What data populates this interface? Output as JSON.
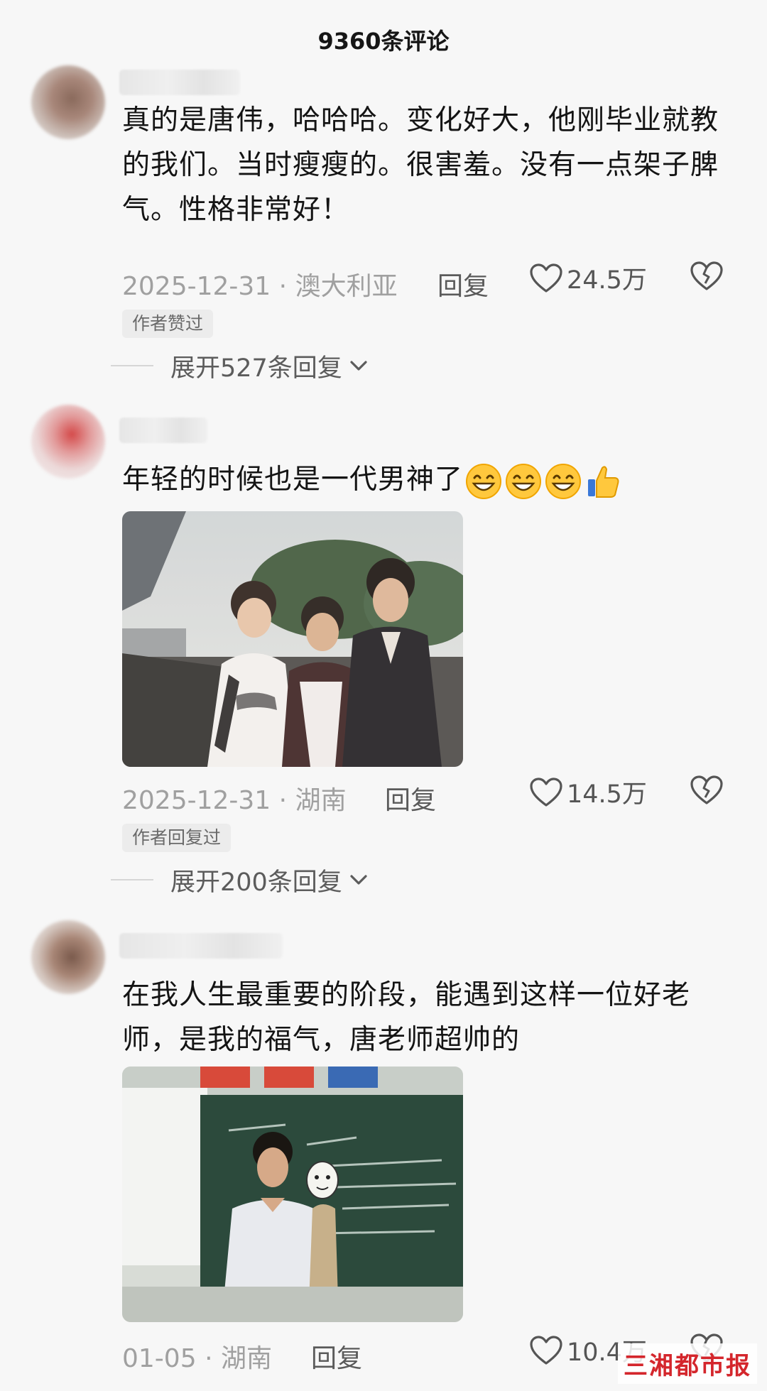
{
  "header": {
    "title": "9360条评论"
  },
  "comments": [
    {
      "text": "真的是唐伟，哈哈哈。变化好大，他刚毕业就教的我们。当时瘦瘦的。很害羞。没有一点架子脾气。性格非常好！",
      "date": "2025-12-31",
      "location": "澳大利亚",
      "reply_label": "回复",
      "likes": "24.5万",
      "tag": "作者赞过",
      "expand_label": "展开527条回复"
    },
    {
      "text": "年轻的时候也是一代男神了",
      "emojis": [
        "grin-icon",
        "grin-icon",
        "grin-icon",
        "thumbs-up-icon"
      ],
      "date": "2025-12-31",
      "location": "湖南",
      "reply_label": "回复",
      "likes": "14.5万",
      "tag": "作者回复过",
      "expand_label": "展开200条回复"
    },
    {
      "text": "在我人生最重要的阶段，能遇到这样一位好老师，是我的福气，唐老师超帅的",
      "date": "01-05",
      "location": "湖南",
      "reply_label": "回复",
      "likes": "10.4万"
    }
  ],
  "watermark": {
    "text": "三湘都市报"
  },
  "colors": {
    "accent": "#d4262c",
    "meta": "#a0a0a0",
    "background": "#f7f7f7"
  }
}
